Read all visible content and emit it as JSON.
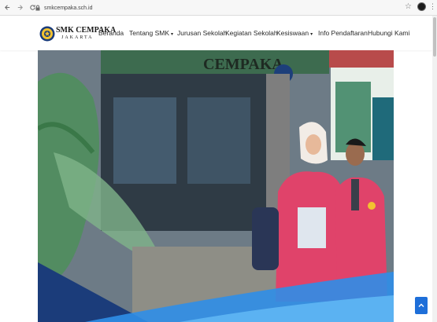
{
  "browser": {
    "url": "smkcempaka.sch.id",
    "back_icon": "arrow-left-icon",
    "forward_icon": "arrow-right-icon",
    "reload_icon": "reload-icon"
  },
  "header": {
    "brand_name": "SMK CEMPAKA",
    "brand_sub": "JAKARTA",
    "menu": [
      {
        "label": "Beranda"
      },
      {
        "label": "Tentang SMK",
        "has_dropdown": true
      },
      {
        "label": "Jurusan Sekolah"
      },
      {
        "label": "Kegiatan Sekolah"
      },
      {
        "label": "Kesiswaan",
        "has_dropdown": true
      },
      {
        "label": "Info Pendaftaran"
      },
      {
        "label": "Hubungi Kami"
      }
    ]
  },
  "hero": {
    "sign_text": "CEMPAKA"
  },
  "colors": {
    "accent": "#1e6fd9",
    "blazer": "#e0436a",
    "wall": "#5f6e7a"
  }
}
